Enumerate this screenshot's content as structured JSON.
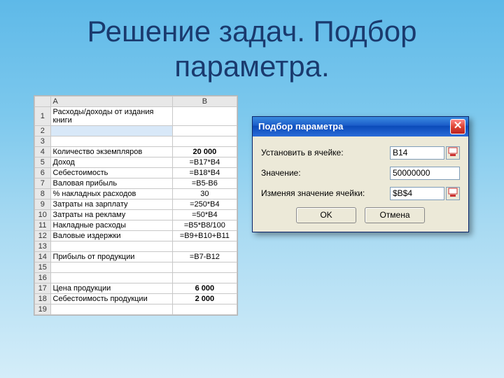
{
  "title": "Решение задач. Подбор параметра.",
  "columns": [
    "",
    "A",
    "B"
  ],
  "rows": [
    {
      "n": "1",
      "a": "Расходы/доходы от издания книги",
      "b": ""
    },
    {
      "n": "2",
      "a": "",
      "b": ""
    },
    {
      "n": "3",
      "a": "",
      "b": ""
    },
    {
      "n": "4",
      "a": "Количество экземпляров",
      "b": "20 000",
      "bold": true
    },
    {
      "n": "5",
      "a": "Доход",
      "b": "=B17*B4"
    },
    {
      "n": "6",
      "a": "Себестоимость",
      "b": "=B18*B4"
    },
    {
      "n": "7",
      "a": "Валовая прибыль",
      "b": "=B5-B6"
    },
    {
      "n": "8",
      "a": "% накладных расходов",
      "b": "30"
    },
    {
      "n": "9",
      "a": "Затраты на зарплату",
      "b": "=250*B4"
    },
    {
      "n": "10",
      "a": "Затраты на рекламу",
      "b": "=50*B4"
    },
    {
      "n": "11",
      "a": "Накладные расходы",
      "b": "=B5*B8/100"
    },
    {
      "n": "12",
      "a": "Валовые издержки",
      "b": "=B9+B10+B11"
    },
    {
      "n": "13",
      "a": "",
      "b": ""
    },
    {
      "n": "14",
      "a": "Прибыль от продукции",
      "b": "=B7-B12"
    },
    {
      "n": "15",
      "a": "",
      "b": ""
    },
    {
      "n": "16",
      "a": "",
      "b": ""
    },
    {
      "n": "17",
      "a": "Цена продукции",
      "b": "6 000",
      "bold": true
    },
    {
      "n": "18",
      "a": "Себестоимость продукции",
      "b": "2 000",
      "bold": true
    },
    {
      "n": "19",
      "a": "",
      "b": ""
    }
  ],
  "dialog": {
    "title": "Подбор параметра",
    "fields": {
      "set_cell_label": "Установить в ячейке:",
      "set_cell_value": "B14",
      "value_label": "Значение:",
      "value_value": "50000000",
      "change_cell_label": "Изменяя значение ячейки:",
      "change_cell_value": "$B$4"
    },
    "buttons": {
      "ok": "OK",
      "cancel": "Отмена"
    }
  }
}
